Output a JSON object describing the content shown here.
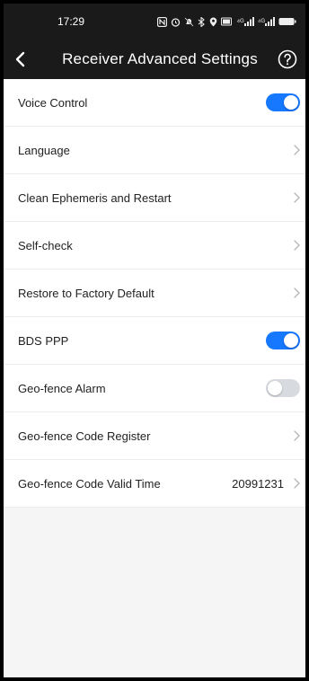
{
  "status_bar": {
    "time": "17:29",
    "icons": [
      "nfc-icon",
      "alarm-icon",
      "mute-icon",
      "bluetooth-icon",
      "location-icon",
      "battery-saver-icon",
      "signal-icon",
      "signal-icon",
      "battery-icon"
    ],
    "signal_label_1": "⁴ᴳ",
    "signal_label_2": "⁴ᴳ"
  },
  "header": {
    "title": "Receiver Advanced Settings",
    "back_icon": "chevron-left-icon",
    "help_icon": "help-circle-icon"
  },
  "colors": {
    "accent": "#1677ff",
    "toggle_off": "#d7dbe0",
    "header_bg": "#1a1a1a"
  },
  "settings": [
    {
      "label": "Voice Control",
      "type": "toggle",
      "on": true
    },
    {
      "label": "Language",
      "type": "nav"
    },
    {
      "label": "Clean Ephemeris and Restart",
      "type": "nav"
    },
    {
      "label": "Self-check",
      "type": "nav"
    },
    {
      "label": "Restore to Factory Default",
      "type": "nav"
    },
    {
      "label": "BDS PPP",
      "type": "toggle",
      "on": true
    },
    {
      "label": "Geo-fence Alarm",
      "type": "toggle",
      "on": false
    },
    {
      "label": "Geo-fence Code Register",
      "type": "nav"
    },
    {
      "label": "Geo-fence Code Valid Time",
      "type": "nav",
      "value": "20991231"
    }
  ]
}
